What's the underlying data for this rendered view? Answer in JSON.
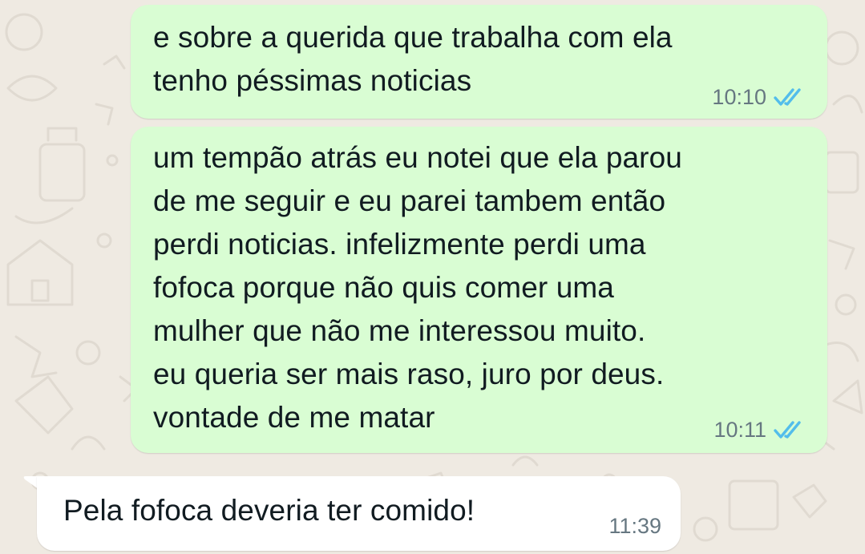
{
  "chat": {
    "messages": [
      {
        "direction": "outgoing",
        "text": "e sobre a querida que trabalha com ela\ntenho péssimas noticias",
        "time": "10:10",
        "status_icon": "double-check-read-icon"
      },
      {
        "direction": "outgoing",
        "text": "um tempão atrás eu notei que ela parou\nde me seguir e eu parei tambem então\nperdi noticias. infelizmente perdi uma\nfofoca porque não quis comer uma\nmulher que não me interessou muito.\neu queria ser mais raso, juro por deus.\nvontade de me matar",
        "time": "10:11",
        "status_icon": "double-check-read-icon"
      },
      {
        "direction": "incoming",
        "text": "Pela fofoca deveria ter comido!",
        "time": "11:39"
      }
    ]
  },
  "colors": {
    "outgoing_bubble": "#d9fdd3",
    "incoming_bubble": "#ffffff",
    "wallpaper": "#efeae2",
    "read_ticks": "#53bdeb",
    "meta_text": "#667781"
  }
}
